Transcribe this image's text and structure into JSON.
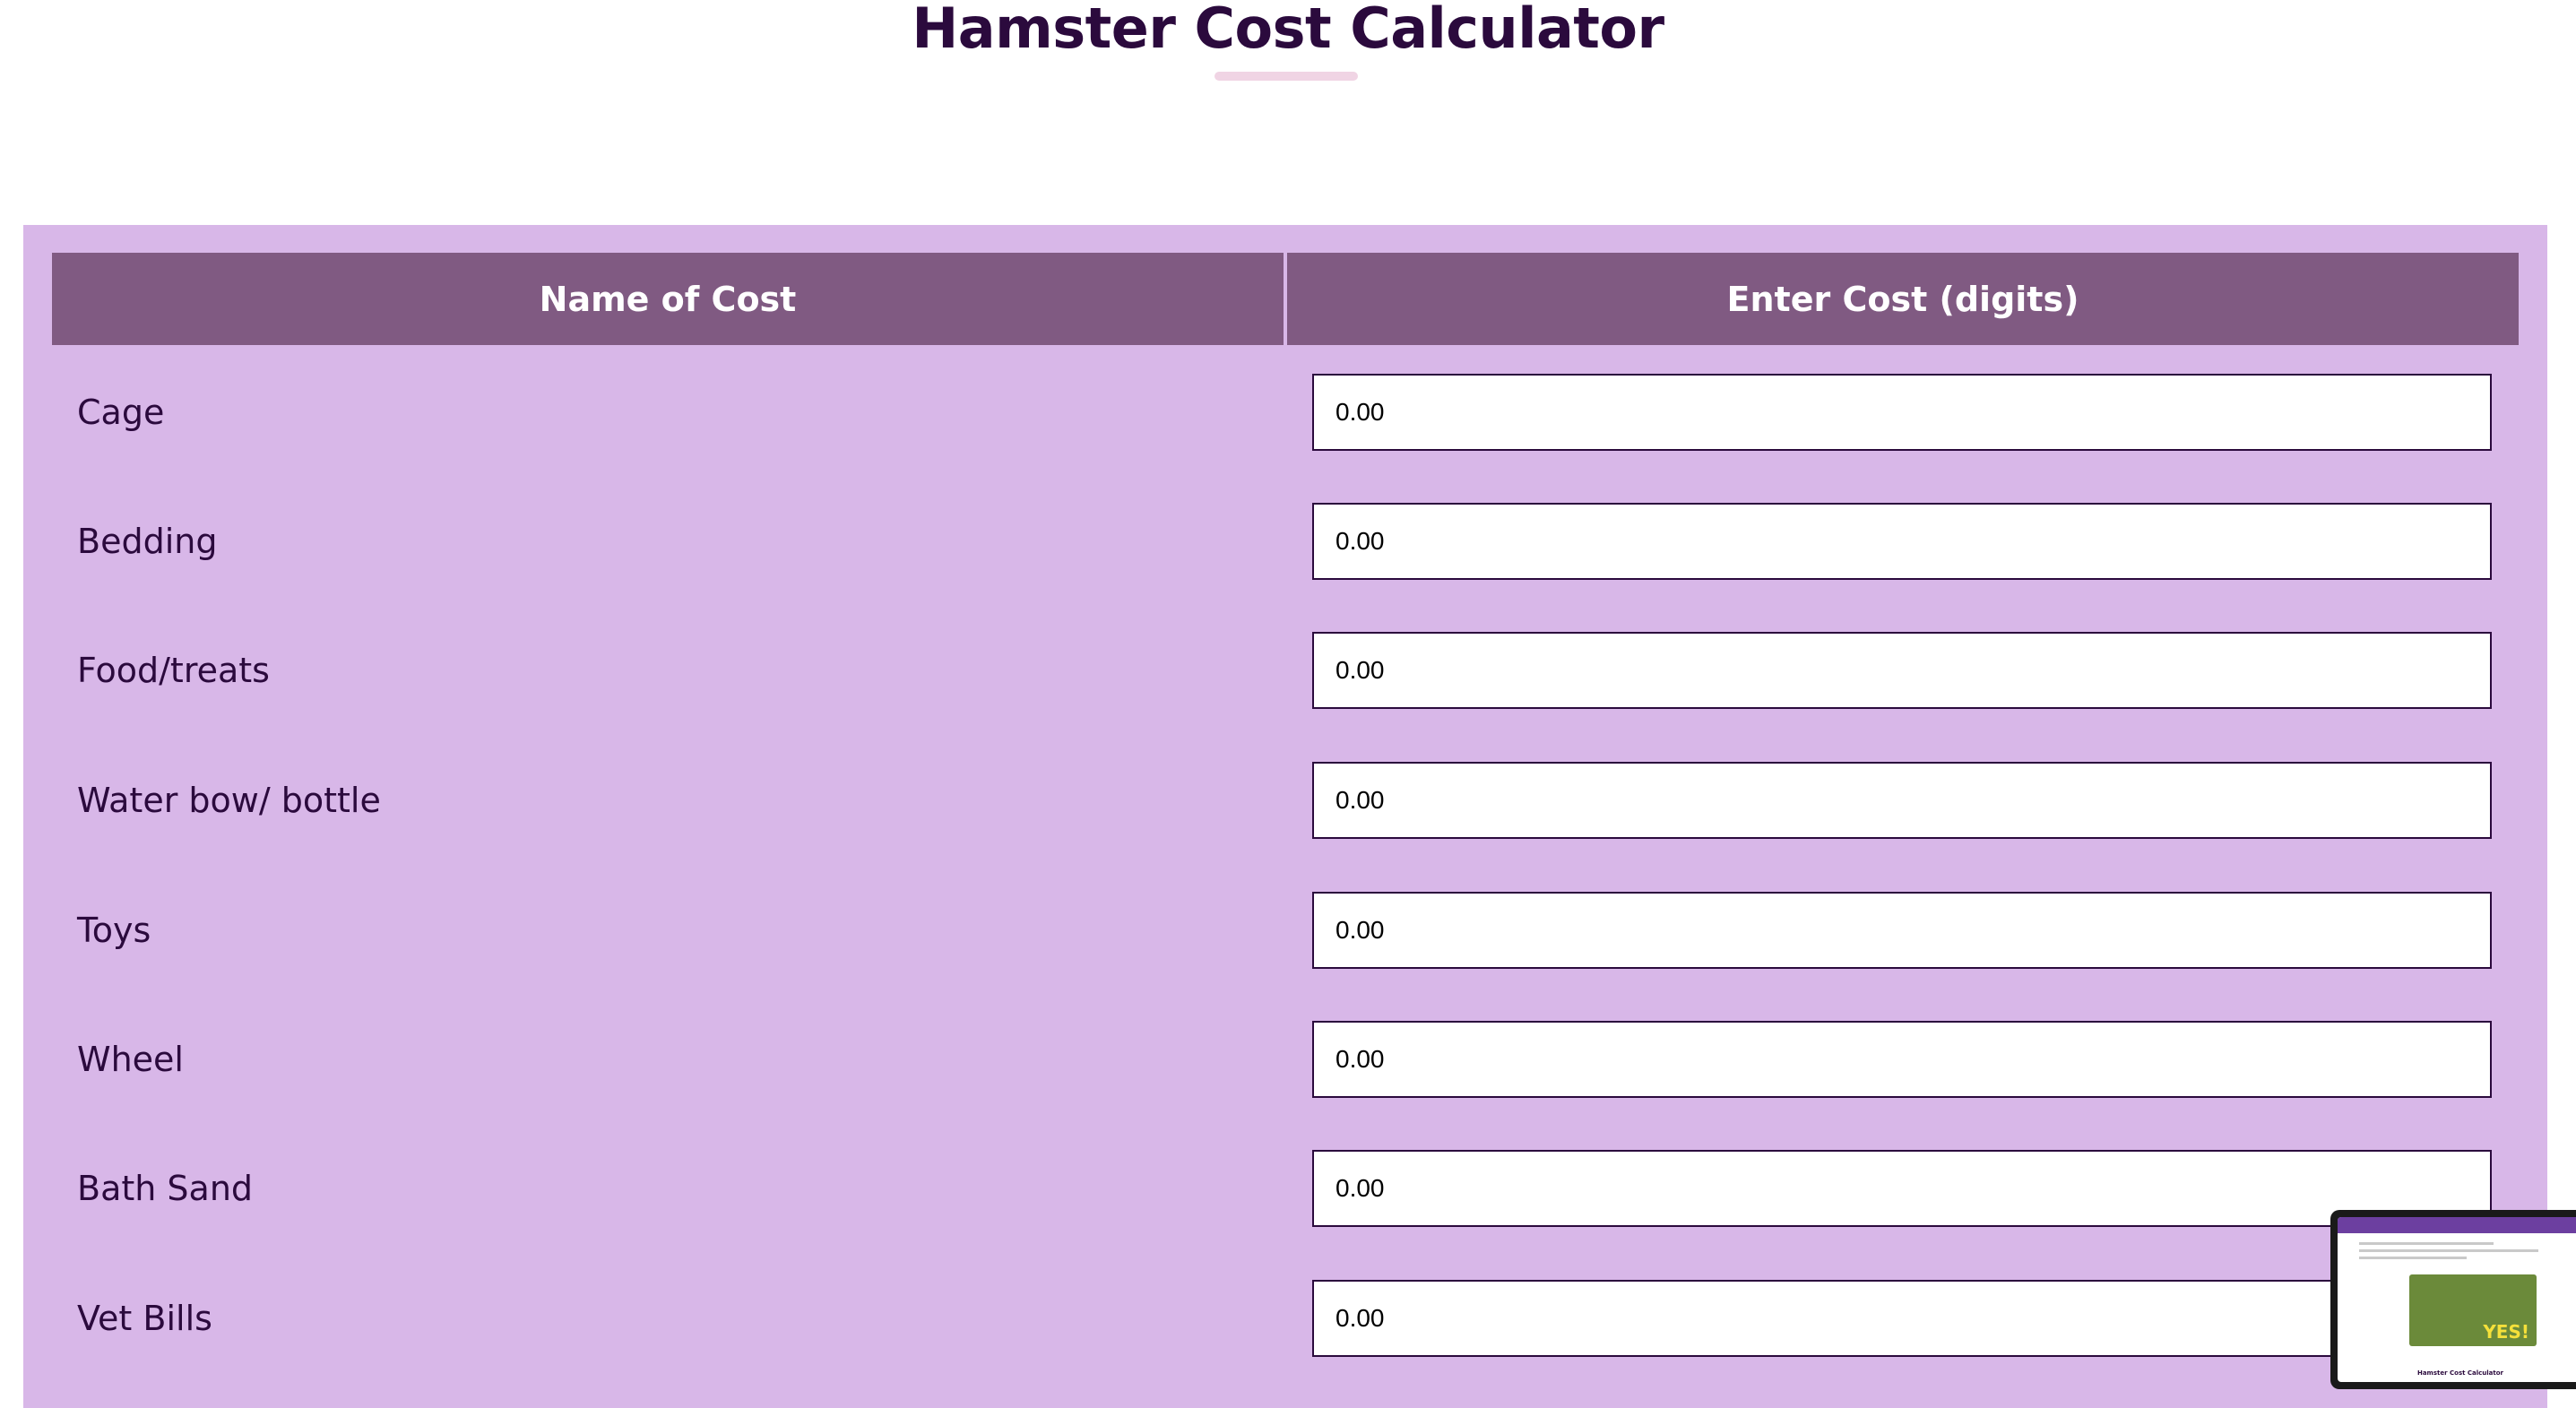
{
  "page": {
    "title": "Hamster Cost Calculator"
  },
  "table": {
    "header_name": "Name of Cost",
    "header_cost": "Enter Cost (digits)",
    "rows": [
      {
        "label": "Cage",
        "value": "0.00"
      },
      {
        "label": "Bedding",
        "value": "0.00"
      },
      {
        "label": "Food/treats",
        "value": "0.00"
      },
      {
        "label": "Water bow/ bottle",
        "value": "0.00"
      },
      {
        "label": "Toys",
        "value": "0.00"
      },
      {
        "label": "Wheel",
        "value": "0.00"
      },
      {
        "label": "Bath Sand",
        "value": "0.00"
      },
      {
        "label": "Vet Bills",
        "value": "0.00"
      }
    ]
  },
  "thumbnail": {
    "image_text": "YES!",
    "caption": "Hamster Cost Calculator"
  },
  "colors": {
    "title": "#2b0a3d",
    "panel_bg": "#d8b7e8",
    "header_bg": "#805a82",
    "header_text": "#ffffff",
    "underline": "#f0d4e4"
  }
}
